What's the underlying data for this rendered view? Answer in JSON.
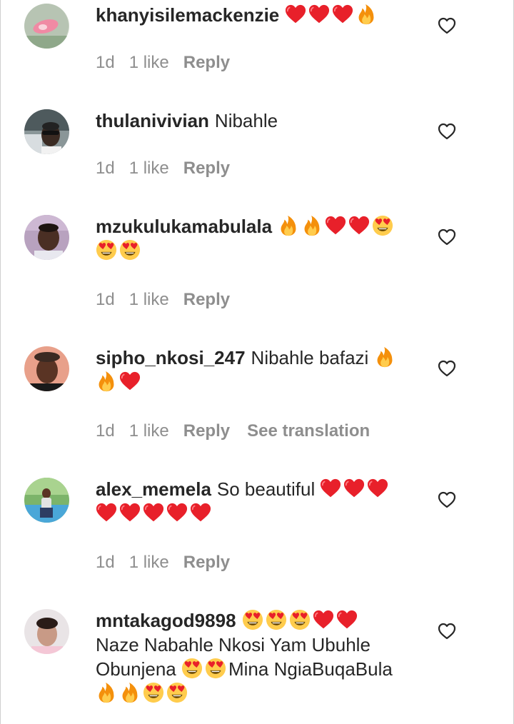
{
  "comments": [
    {
      "username": "khanyisilemackenzie",
      "body": "",
      "emojis": [
        "heart",
        "heart",
        "heart",
        "fire"
      ],
      "time": "1d",
      "likes": "1 like",
      "reply": "Reply"
    },
    {
      "username": "thulanivivian",
      "body": "Nibahle",
      "emojis": [],
      "time": "1d",
      "likes": "1 like",
      "reply": "Reply"
    },
    {
      "username": "mzukulukamabulala",
      "body": "",
      "emojis": [
        "fire",
        "fire",
        "heart",
        "heart",
        "heart-eyes",
        "heart-eyes",
        "heart-eyes"
      ],
      "time": "1d",
      "likes": "1 like",
      "reply": "Reply"
    },
    {
      "username": "sipho_nkosi_247",
      "body": "Nibahle bafazi",
      "emojis": [
        "fire",
        "fire",
        "heart"
      ],
      "time": "1d",
      "likes": "1 like",
      "reply": "Reply",
      "translation": "See translation"
    },
    {
      "username": "alex_memela",
      "body": "So beautiful",
      "emojis": [
        "heart",
        "heart",
        "heart",
        "heart",
        "heart",
        "heart",
        "heart",
        "heart"
      ],
      "time": "1d",
      "likes": "1 like",
      "reply": "Reply"
    },
    {
      "username": "mntakagod9898",
      "body": "",
      "emojis": [
        "heart-eyes",
        "heart-eyes",
        "heart-eyes",
        "heart",
        "heart"
      ],
      "line2": "Naze Nabahle Nkosi Yam Ubuhle",
      "line3_text": "Obunjena",
      "line3_emojis": [
        "heart-eyes",
        "heart-eyes"
      ],
      "line3_after": "Mina NgiaBuqaBula",
      "line4_emojis": [
        "fire",
        "fire",
        "heart-eyes",
        "heart-eyes"
      ]
    }
  ],
  "icons": {
    "like": "heart-outline-icon",
    "heart": "red-heart-emoji",
    "fire": "fire-emoji",
    "heart-eyes": "heart-eyes-emoji"
  },
  "colors": {
    "text": "#262626",
    "meta": "#8e8e8e",
    "heart": "#e8202a"
  }
}
